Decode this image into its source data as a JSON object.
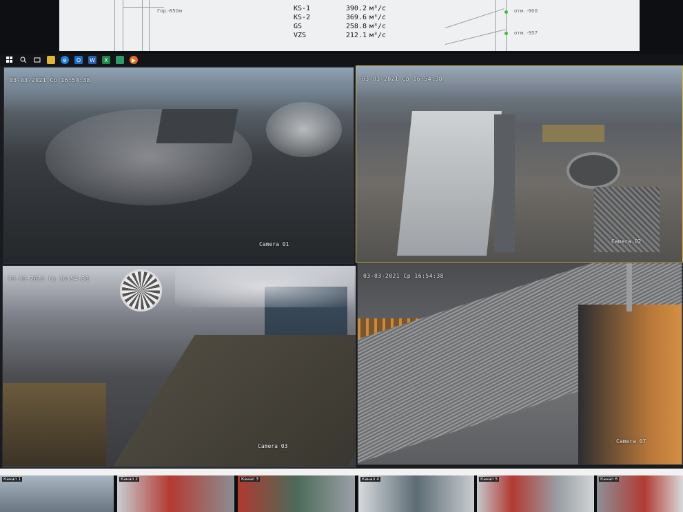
{
  "flow_table": [
    {
      "name": "KS-1",
      "value": "390.2",
      "unit": "м³/с"
    },
    {
      "name": "KS-2",
      "value": "369.6",
      "unit": "м³/с"
    },
    {
      "name": "GS",
      "value": "258.8",
      "unit": "м³/с"
    },
    {
      "name": "VZS",
      "value": "212.1",
      "unit": "м³/с"
    }
  ],
  "diagram_labels": {
    "left": "Гор.-850м",
    "right_top": "отм. -900",
    "right_mid": "отм. -957"
  },
  "taskbar": {
    "icons": [
      "windows-start-icon",
      "search-icon",
      "task-view-icon",
      "file-explorer-icon",
      "edge-icon",
      "outlook-icon",
      "word-icon",
      "excel-icon",
      "app-icon",
      "media-player-icon"
    ]
  },
  "cameras": [
    {
      "timestamp": "03-03-2021 Ср 16:54:38",
      "label": "Camera 01"
    },
    {
      "timestamp": "03-03-2021 Ср 16:54:38",
      "label": "Camera 02"
    },
    {
      "timestamp": "03-03-2021 Ср 16:54:38",
      "label": "Camera 03"
    },
    {
      "timestamp": "03-03-2021 Ср 16:54:38",
      "label": "Camera 07"
    }
  ],
  "channels": [
    "Канал 1",
    "Канал 2",
    "Канал 3",
    "Канал 4",
    "Канал 5",
    "Канал 6"
  ],
  "colors": {
    "selected_border": "#d8b54a",
    "flow_dot": "#3dbb3d"
  }
}
